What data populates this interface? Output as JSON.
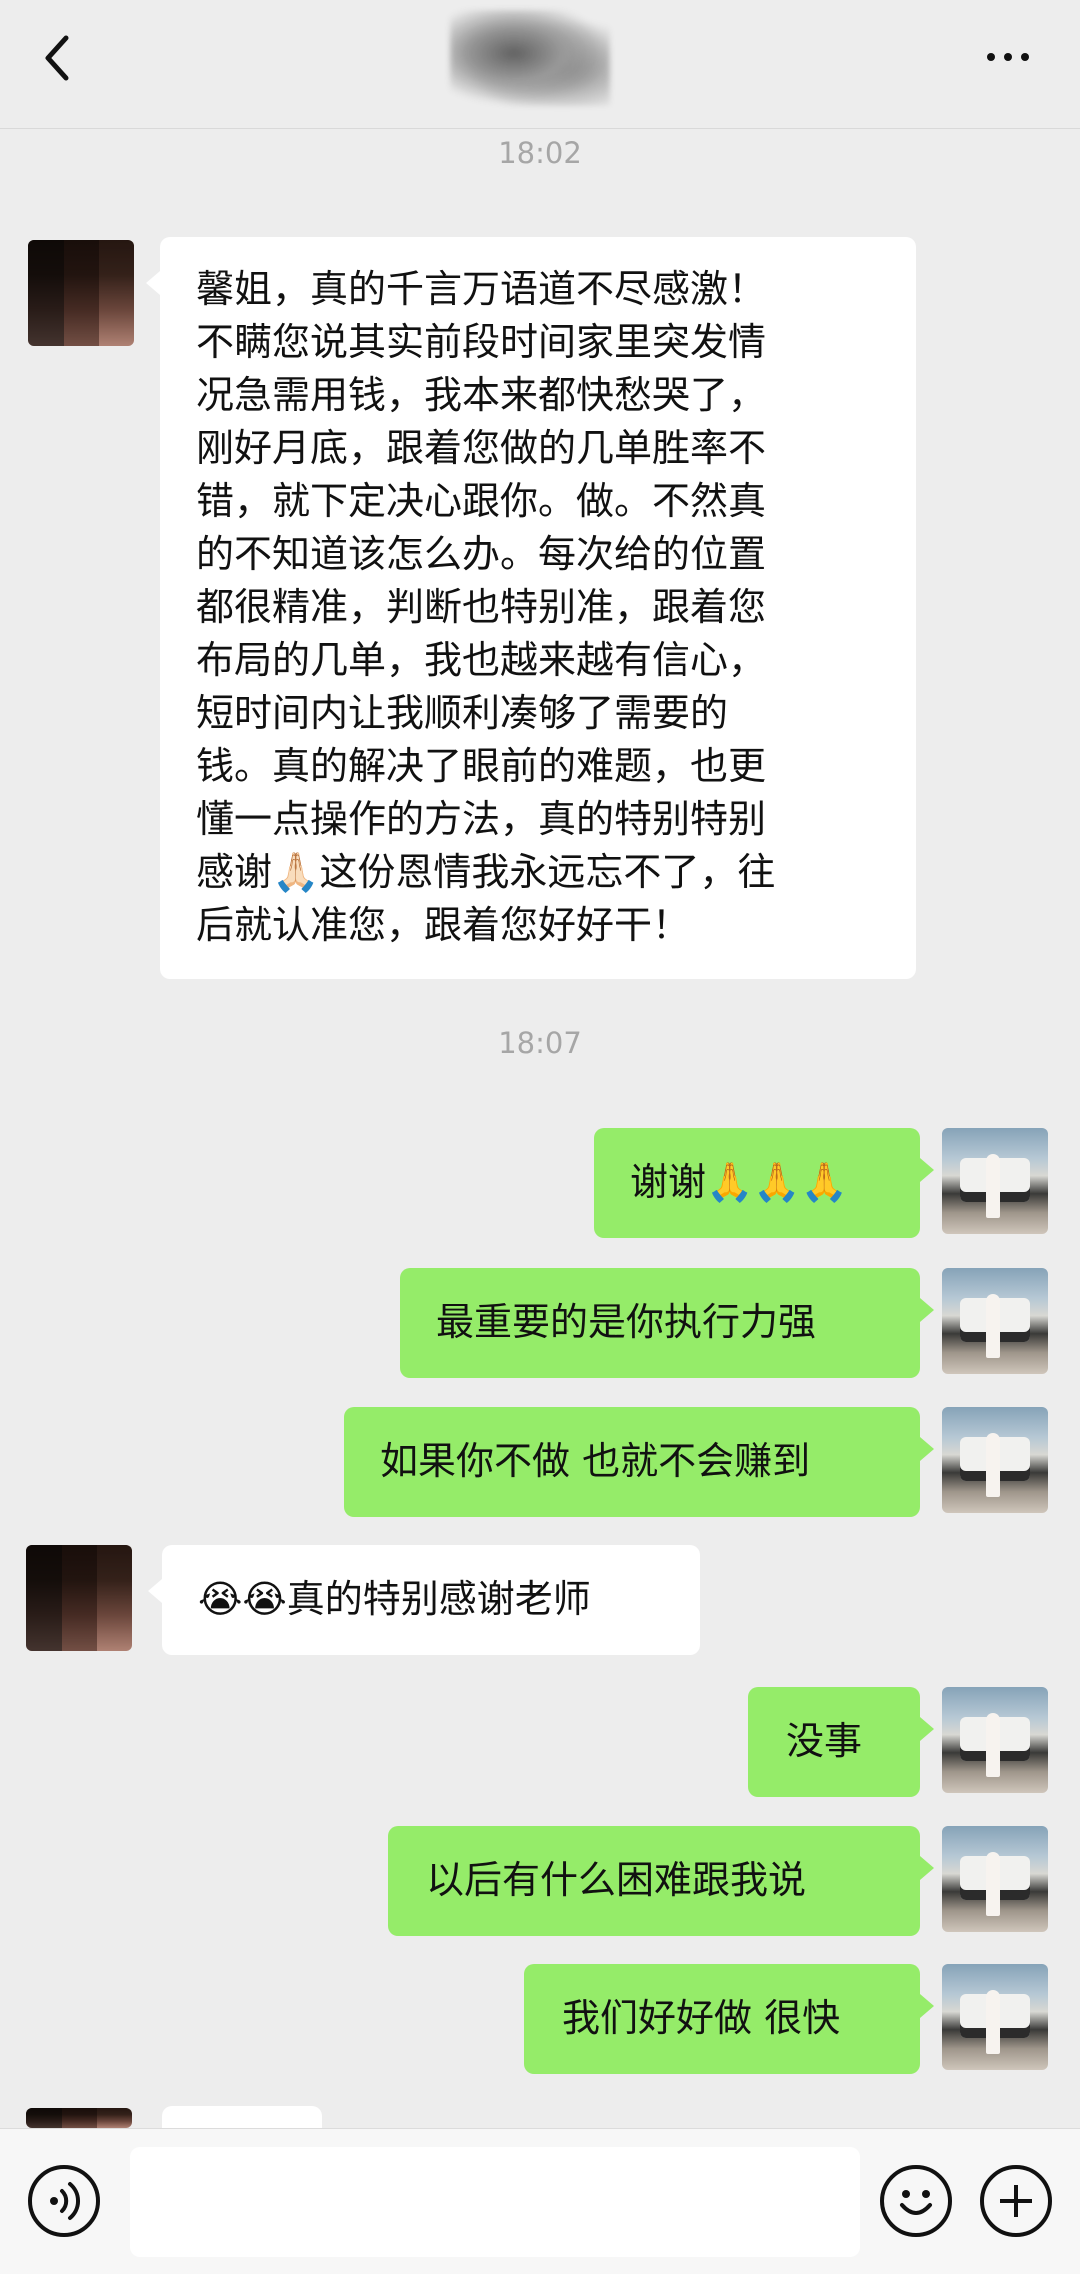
{
  "header": {
    "title_icon": "blurred-contact-name",
    "back_icon": "chevron-left-icon",
    "more_icon": "more-dots-icon"
  },
  "timestamps": [
    "18:02",
    "18:07"
  ],
  "messages": [
    {
      "side": "left",
      "text": "馨姐，真的千言万语道不尽感激！\n不瞒您说其实前段时间家里突发情\n况急需用钱，我本来都快愁哭了，\n刚好月底，跟着您做的几单胜率不\n错，就下定决心跟你。做。不然真\n的不知道该怎么办。每次给的位置\n都很精准，判断也特别准，跟着您\n布局的几单，我也越来越有信心，\n短时间内让我顺利凑够了需要的\n钱。真的解决了眼前的难题，也更\n懂一点操作的方法，真的特别特别\n感谢🙏🏻这份恩情我永远忘不了，往\n后就认准您，跟着您好好干！"
    },
    {
      "side": "right",
      "text": "谢谢🙏🙏🙏"
    },
    {
      "side": "right",
      "text": "最重要的是你执行力强"
    },
    {
      "side": "right",
      "text": "如果你不做 也就不会赚到"
    },
    {
      "side": "left",
      "text": "😭😭真的特别感谢老师"
    },
    {
      "side": "right",
      "text": "没事"
    },
    {
      "side": "right",
      "text": "以后有什么困难跟我说"
    },
    {
      "side": "right",
      "text": "我们好好做 很快"
    }
  ],
  "input": {
    "placeholder": "",
    "value": ""
  },
  "toolbar": {
    "voice_icon": "voice-icon",
    "emoji_icon": "emoji-icon",
    "plus_icon": "plus-icon"
  }
}
